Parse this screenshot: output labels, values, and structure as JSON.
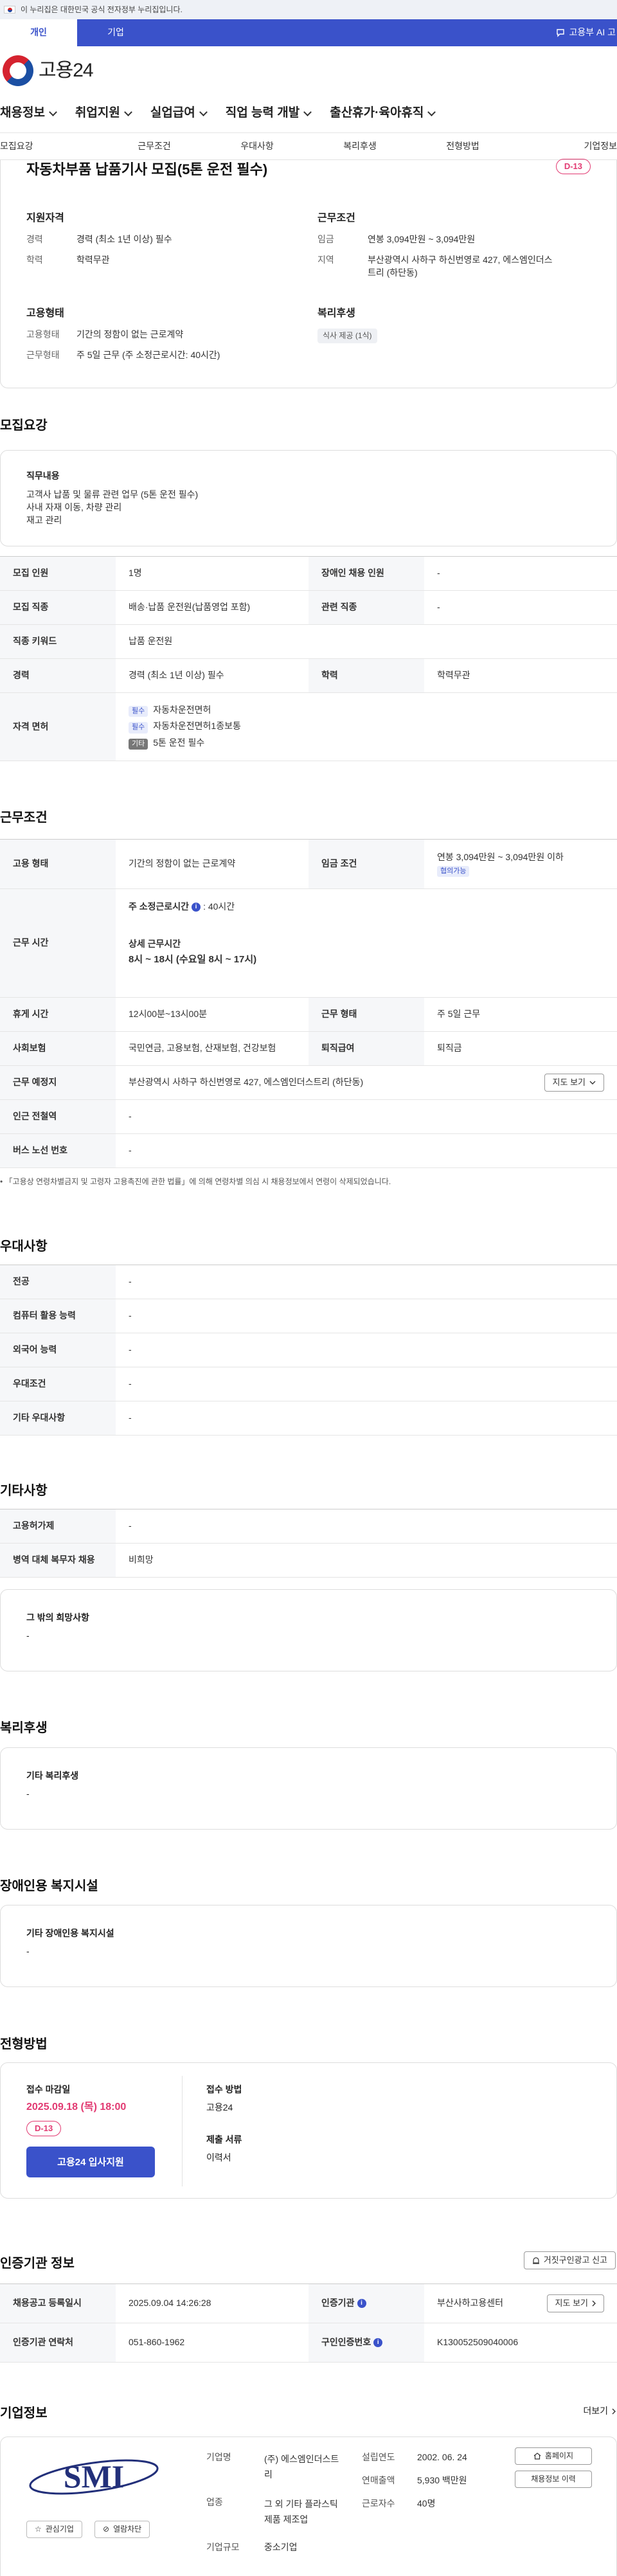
{
  "gov_banner": "이 누리집은 대한민국 공식 전자정부 누리집입니다.",
  "top_tabs": [
    "개인",
    "기업"
  ],
  "ai_link": "고용부 AI 고",
  "logo": "고용24",
  "gnb": [
    "채용정보",
    "취업지원",
    "실업급여",
    "직업 능력 개발",
    "출산휴가·육아휴직"
  ],
  "subnav": [
    "모집요강",
    "근무조건",
    "우대사항",
    "복리후생",
    "전형방법",
    "기업정보"
  ],
  "summary": {
    "title": "자동차부품 납품기사 모집(5톤 운전 필수)",
    "dday": "D-13",
    "qual_title": "지원자격",
    "qual": [
      {
        "label": "경력",
        "value": "경력 (최소 1년 이상) 필수"
      },
      {
        "label": "학력",
        "value": "학력무관"
      }
    ],
    "cond_title": "근무조건",
    "cond": [
      {
        "label": "임금",
        "value": "연봉 3,094만원 ~ 3,094만원"
      },
      {
        "label": "지역",
        "value": "부산광역시 사하구 하신번영로 427, 에스엠인더스트리 (하단동)"
      }
    ],
    "emp_title": "고용형태",
    "emp": [
      {
        "label": "고용형태",
        "value": "기간의 정함이 없는 근로계약"
      },
      {
        "label": "근무형태",
        "value": "주 5일 근무 (주 소정근로시간: 40시간)"
      }
    ],
    "welfare_title": "복리후생",
    "welfare_chip": "식사 제공 (1식)"
  },
  "recruit": {
    "heading": "모집요강",
    "duty_title": "직무내용",
    "duty_lines": [
      "고객사 납품 및 물류 관련 업무 (5톤 운전 필수)",
      "사내 자재 이동, 차량 관리",
      "재고 관리"
    ],
    "rows": {
      "count_label": "모집 인원",
      "count": "1명",
      "disabled_label": "장애인 채용 인원",
      "disabled": "-",
      "job_label": "모집 직종",
      "job": "배송·납품 운전원(납품영업 포함)",
      "related_label": "관련 직종",
      "related": "-",
      "keyword_label": "직종 키워드",
      "keyword": "납품 운전원",
      "career_label": "경력",
      "career": "경력 (최소 1년 이상) 필수",
      "edu_label": "학력",
      "edu": "학력무관",
      "license_label": "자격 면허"
    },
    "licenses": [
      {
        "tag": "필수",
        "name": "자동차운전면허"
      },
      {
        "tag": "필수",
        "name": "자동차운전면허1종보통"
      },
      {
        "tag": "기타",
        "name": "5톤 운전 필수"
      }
    ]
  },
  "work": {
    "heading": "근무조건",
    "emp_label": "고용 형태",
    "emp": "기간의 정함이 없는 근로계약",
    "wage_label": "임금 조건",
    "wage": "연봉 3,094만원 ~ 3,094만원 이하",
    "wage_tag": "협의가능",
    "hours_label": "근무 시간",
    "hours_week_label": "주 소정근로시간",
    "hours_week": ": 40시간",
    "hours_detail_label": "상세 근무시간",
    "hours_detail": "8시 ~ 18시 (수요일 8시 ~ 17시)",
    "break_label": "휴게 시간",
    "break": "12시00분~13시00분",
    "type_label": "근무 형태",
    "type": "주 5일 근무",
    "insure_label": "사회보험",
    "insure": "국민연금, 고용보험, 산재보험, 건강보험",
    "retire_label": "퇴직급여",
    "retire": "퇴직금",
    "place_label": "근무 예정지",
    "place": "부산광역시 사하구 하신번영로 427, 에스엠인더스트리 (하단동)",
    "map_btn": "지도 보기",
    "subway_label": "인근 전철역",
    "subway": "-",
    "bus_label": "버스 노선 번호",
    "bus": "-",
    "note": "「고용상 연령차별금지 및 고령자 고용촉진에 관한 법률」에 의해 연령차별 의심 시 채용정보에서 연령이 삭제되었습니다."
  },
  "prefer": {
    "heading": "우대사항",
    "rows": [
      {
        "label": "전공",
        "value": "-"
      },
      {
        "label": "컴퓨터 활용 능력",
        "value": "-"
      },
      {
        "label": "외국어 능력",
        "value": "-"
      },
      {
        "label": "우대조건",
        "value": "-"
      },
      {
        "label": "기타 우대사항",
        "value": "-"
      }
    ]
  },
  "etc": {
    "heading": "기타사항",
    "rows": [
      {
        "label": "고용허가제",
        "value": "-"
      },
      {
        "label": "병역 대체 복무자 채용",
        "value": "비희망"
      }
    ],
    "other_title": "그 밖의 희망사항",
    "other_value": "-"
  },
  "welfare": {
    "heading": "복리후생",
    "title": "기타 복리후생",
    "value": "-"
  },
  "disability": {
    "heading": "장애인용 복지시설",
    "title": "기타 장애인용 복지시설",
    "value": "-"
  },
  "selection": {
    "heading": "전형방법",
    "deadline_label": "접수 마감일",
    "deadline": "2025.09.18 (목) 18:00",
    "dday": "D-13",
    "apply_btn": "고용24 입사지원",
    "method_label": "접수 방법",
    "method": "고용24",
    "docs_label": "제출 서류",
    "docs": "이력서"
  },
  "agency": {
    "heading": "인증기관 정보",
    "report_btn": "거짓구인광고 신고",
    "reg_label": "채용공고 등록일시",
    "reg": "2025.09.04 14:26:28",
    "org_label": "인증기관",
    "org": "부산사하고용센터",
    "map_btn": "지도 보기",
    "tel_label": "인증기관 연락처",
    "tel": "051-860-1962",
    "id_label": "구인인증번호",
    "id": "K130052509040006"
  },
  "company": {
    "heading": "기업정보",
    "more": "더보기",
    "logo_text": "SMI",
    "interest_btn": "관심기업",
    "block_btn": "열람차단",
    "name_label": "기업명",
    "name": "(주) 에스엠인더스트리",
    "industry_label": "업종",
    "industry": "그 외 기타 플라스틱 제품 제조업",
    "scale_label": "기업규모",
    "scale": "중소기업",
    "founded_label": "설립연도",
    "founded": "2002. 06. 24",
    "revenue_label": "연매출액",
    "revenue": "5,930 백만원",
    "staff_label": "근로자수",
    "staff": "40명",
    "homepage_btn": "홈페이지",
    "jobs_btn": "채용정보 이력"
  }
}
